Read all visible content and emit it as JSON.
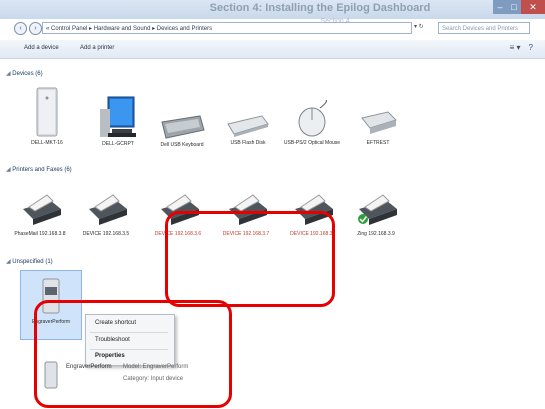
{
  "window": {
    "overlay_title": "Section 4: Installing the Epilog Dashboard",
    "overlay_subtitle": "Section 4",
    "minimize": "–",
    "maximize": "□",
    "close": "✕"
  },
  "nav": {
    "back": "‹",
    "forward": "›"
  },
  "address": {
    "path": "« Control Panel ▸ Hardware and Sound ▸ Devices and Printers",
    "controls": "▾ ↻",
    "search_placeholder": "Search Devices and Printers"
  },
  "toolbar": {
    "add_device": "Add a device",
    "add_printer": "Add a printer",
    "view_icon": "≡ ▾",
    "help_icon": "?"
  },
  "sections": {
    "devices": {
      "toggle": "◢",
      "label": "Devices (6)"
    },
    "printers": {
      "toggle": "◢",
      "label": "Printers and Faxes (6)"
    },
    "unspecified": {
      "toggle": "◢",
      "label": "Unspecified (1)"
    }
  },
  "devices": [
    {
      "label": "DELL-MKT-16"
    },
    {
      "label": "DELL-GCRPT"
    },
    {
      "label": "Dell USB Keyboard"
    },
    {
      "label": "USB Flash Disk"
    },
    {
      "label": "USB-PS/2 Optical Mouse"
    },
    {
      "label": "EFTREST"
    }
  ],
  "printers": [
    {
      "label": "PhaseMail 192.168.3.8",
      "red": false
    },
    {
      "label": "DEVICE 192.168.3.5",
      "red": false
    },
    {
      "label": "DEVICE 192.168.3.6",
      "red": true
    },
    {
      "label": "DEVICE 192.168.3.7",
      "red": true
    },
    {
      "label": "DEVICE 192.168.3.",
      "red": true
    },
    {
      "label": "Zing 192.168.3.9",
      "red": false
    }
  ],
  "unspecified_device": {
    "label": "EngraverPerform"
  },
  "context_menu": {
    "items": [
      "Create shortcut",
      "Troubleshoot",
      "Properties"
    ]
  },
  "details": {
    "name": "EngraverPerform",
    "model": "Model: EngraverPerform",
    "category": "Category: Input device"
  },
  "colors": {
    "highlight": "#e60000",
    "link": "#1e3a64",
    "red_label": "#c0392b"
  }
}
